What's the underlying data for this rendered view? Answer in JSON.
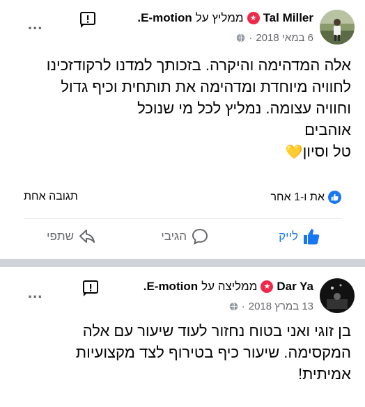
{
  "posts": [
    {
      "author": "Tal Miller",
      "recommend_text": "ממליץ על",
      "page": "E-motion.",
      "date": "6 במאי 2018",
      "separator_dot": "·",
      "more_label": "...",
      "body_lines": [
        "אלה המדהימה והיקרה. בזכותך למדנו לרקודזכינו",
        "לחוויה מיוחדת ומדהימה את תותחית וכיף גדול",
        "וחוויה עצומה. נמליץ לכל מי שנוכל",
        "אוהבים",
        "טל וסיון"
      ],
      "emoji": "💛",
      "reactions_text": "את ו-1 אחר",
      "replies_text": "תגובה אחת",
      "actions": {
        "like": "לייק",
        "comment": "הגיבי",
        "share": "שתפי"
      }
    },
    {
      "author": "Dar Ya",
      "recommend_text": "ממליצה על",
      "page": "E-motion.",
      "date": "13 במרץ 2018",
      "separator_dot": "·",
      "more_label": "...",
      "body_lines": [
        "בן זוגי ואני בטוח נחזור לעוד שיעור עם אלה",
        "המקסימה. שיעור כיף בטירוף לצד מקצועיות",
        "אמיתית!"
      ]
    }
  ],
  "colors": {
    "accent_blue": "#1877f2",
    "recommend_red": "#f02849",
    "secondary_text": "#65676b",
    "separator": "#cfd3d8"
  },
  "icons": {
    "recommend": "star-badge-icon",
    "privacy": "globe-icon",
    "report": "flag-icon",
    "like": "thumbs-up-icon",
    "comment": "comment-bubble-icon",
    "share": "share-arrow-icon"
  }
}
